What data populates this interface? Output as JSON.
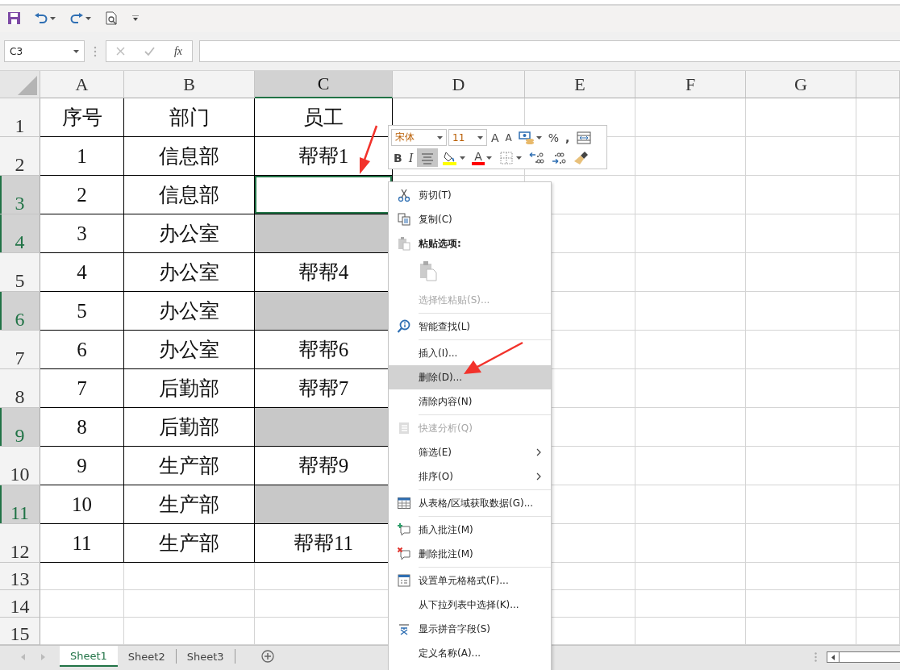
{
  "name_box": {
    "value": "C3"
  },
  "formula_bar": {
    "function_label": "fx"
  },
  "columns": [
    {
      "label": "A",
      "selected": false
    },
    {
      "label": "B",
      "selected": false
    },
    {
      "label": "C",
      "selected": true
    },
    {
      "label": "D",
      "selected": false
    },
    {
      "label": "E",
      "selected": false
    },
    {
      "label": "F",
      "selected": false
    },
    {
      "label": "G",
      "selected": false
    }
  ],
  "rows": [
    {
      "header": "1",
      "selected": false,
      "cells": [
        {
          "text": "序号",
          "selected": false,
          "active": false
        },
        {
          "text": "部门",
          "selected": false,
          "active": false
        },
        {
          "text": "员工",
          "selected": false,
          "active": false
        }
      ]
    },
    {
      "header": "2",
      "selected": false,
      "cells": [
        {
          "text": "1",
          "selected": false,
          "active": false
        },
        {
          "text": "信息部",
          "selected": false,
          "active": false
        },
        {
          "text": "帮帮1",
          "selected": false,
          "active": false
        }
      ]
    },
    {
      "header": "3",
      "selected": true,
      "cells": [
        {
          "text": "2",
          "selected": false,
          "active": false
        },
        {
          "text": "信息部",
          "selected": false,
          "active": false
        },
        {
          "selected": true,
          "active": true
        }
      ]
    },
    {
      "header": "4",
      "selected": true,
      "cells": [
        {
          "text": "3",
          "selected": false,
          "active": false
        },
        {
          "text": "办公室",
          "selected": false,
          "active": false
        },
        {
          "selected": true,
          "active": false
        }
      ]
    },
    {
      "header": "5",
      "selected": false,
      "cells": [
        {
          "text": "4",
          "selected": false,
          "active": false
        },
        {
          "text": "办公室",
          "selected": false,
          "active": false
        },
        {
          "text": "帮帮4",
          "selected": false,
          "active": false
        }
      ]
    },
    {
      "header": "6",
      "selected": true,
      "cells": [
        {
          "text": "5",
          "selected": false,
          "active": false
        },
        {
          "text": "办公室",
          "selected": false,
          "active": false
        },
        {
          "selected": true,
          "active": false
        }
      ]
    },
    {
      "header": "7",
      "selected": false,
      "cells": [
        {
          "text": "6",
          "selected": false,
          "active": false
        },
        {
          "text": "办公室",
          "selected": false,
          "active": false
        },
        {
          "text": "帮帮6",
          "selected": false,
          "active": false
        }
      ]
    },
    {
      "header": "8",
      "selected": false,
      "cells": [
        {
          "text": "7",
          "selected": false,
          "active": false
        },
        {
          "text": "后勤部",
          "selected": false,
          "active": false
        },
        {
          "text": "帮帮7",
          "selected": false,
          "active": false
        }
      ]
    },
    {
      "header": "9",
      "selected": true,
      "cells": [
        {
          "text": "8",
          "selected": false,
          "active": false
        },
        {
          "text": "后勤部",
          "selected": false,
          "active": false
        },
        {
          "selected": true,
          "active": false
        }
      ]
    },
    {
      "header": "10",
      "selected": false,
      "cells": [
        {
          "text": "9",
          "selected": false,
          "active": false
        },
        {
          "text": "生产部",
          "selected": false,
          "active": false
        },
        {
          "text": "帮帮9",
          "selected": false,
          "active": false
        }
      ]
    },
    {
      "header": "11",
      "selected": true,
      "cells": [
        {
          "text": "10",
          "selected": false,
          "active": false
        },
        {
          "text": "生产部",
          "selected": false,
          "active": false
        },
        {
          "selected": true,
          "active": false
        }
      ]
    },
    {
      "header": "12",
      "selected": false,
      "cells": [
        {
          "text": "11",
          "selected": false,
          "active": false
        },
        {
          "text": "生产部",
          "selected": false,
          "active": false
        },
        {
          "text": "帮帮11",
          "selected": false,
          "active": false
        }
      ]
    },
    {
      "header": "13",
      "selected": false
    },
    {
      "header": "14",
      "selected": false
    },
    {
      "header": "15",
      "selected": false
    }
  ],
  "mini_toolbar": {
    "font": "宋体",
    "size": "11",
    "top_buttons": [
      {
        "kind": "grow-font",
        "label": "A"
      },
      {
        "kind": "shrink-font",
        "label": "A"
      },
      {
        "kind": "accounting"
      },
      {
        "kind": "percent",
        "label": "%"
      },
      {
        "kind": "comma",
        "label": ","
      },
      {
        "kind": "merge"
      }
    ],
    "bottom_buttons": [
      {
        "kind": "bold",
        "label": "B",
        "selected": false
      },
      {
        "kind": "italic",
        "label": "I",
        "selected": false
      },
      {
        "kind": "align-center",
        "selected": true
      },
      {
        "kind": "fill-color",
        "color": "#ffff00"
      },
      {
        "kind": "font-color",
        "label": "A",
        "color": "#ff0000"
      },
      {
        "kind": "borders"
      },
      {
        "kind": "increase-decimal"
      },
      {
        "kind": "decrease-decimal"
      },
      {
        "kind": "format-painter"
      }
    ]
  },
  "context_menu": {
    "items": [
      {
        "kind": "item",
        "label": "剪切(T)",
        "disabled": false,
        "selected": false,
        "submenu": false
      },
      {
        "kind": "item",
        "label": "复制(C)",
        "disabled": false,
        "selected": false,
        "submenu": false
      },
      {
        "kind": "header",
        "label": "粘贴选项:"
      },
      {
        "kind": "paste-options"
      },
      {
        "kind": "item",
        "label": "选择性粘贴(S)...",
        "disabled": true,
        "selected": false,
        "submenu": false
      },
      {
        "kind": "separator"
      },
      {
        "kind": "item",
        "label": "智能查找(L)",
        "disabled": false,
        "selected": false,
        "submenu": false
      },
      {
        "kind": "separator"
      },
      {
        "kind": "item",
        "label": "插入(I)...",
        "disabled": false,
        "selected": false,
        "submenu": false
      },
      {
        "kind": "item",
        "label": "删除(D)...",
        "disabled": false,
        "selected": true,
        "submenu": false
      },
      {
        "kind": "item",
        "label": "清除内容(N)",
        "disabled": false,
        "selected": false,
        "submenu": false
      },
      {
        "kind": "separator"
      },
      {
        "kind": "item",
        "label": "快速分析(Q)",
        "disabled": true,
        "selected": false,
        "submenu": false
      },
      {
        "kind": "item",
        "label": "筛选(E)",
        "disabled": false,
        "selected": false,
        "submenu": true
      },
      {
        "kind": "item",
        "label": "排序(O)",
        "disabled": false,
        "selected": false,
        "submenu": true
      },
      {
        "kind": "separator"
      },
      {
        "kind": "item",
        "label": "从表格/区域获取数据(G)...",
        "disabled": false,
        "selected": false,
        "submenu": false
      },
      {
        "kind": "separator"
      },
      {
        "kind": "item",
        "label": "插入批注(M)",
        "disabled": false,
        "selected": false,
        "submenu": false
      },
      {
        "kind": "item",
        "label": "删除批注(M)",
        "disabled": false,
        "selected": false,
        "submenu": false
      },
      {
        "kind": "separator"
      },
      {
        "kind": "item",
        "label": "设置单元格格式(F)...",
        "disabled": false,
        "selected": false,
        "submenu": false
      },
      {
        "kind": "item",
        "label": "从下拉列表中选择(K)...",
        "disabled": false,
        "selected": false,
        "submenu": false
      },
      {
        "kind": "item",
        "label": "显示拼音字段(S)",
        "disabled": false,
        "selected": false,
        "submenu": false
      },
      {
        "kind": "item",
        "label": "定义名称(A)...",
        "disabled": false,
        "selected": false,
        "submenu": false
      }
    ]
  },
  "sheet_tabs": [
    {
      "label": "Sheet1",
      "selected": true
    },
    {
      "label": "Sheet2",
      "selected": false
    },
    {
      "label": "Sheet3",
      "selected": false
    }
  ]
}
